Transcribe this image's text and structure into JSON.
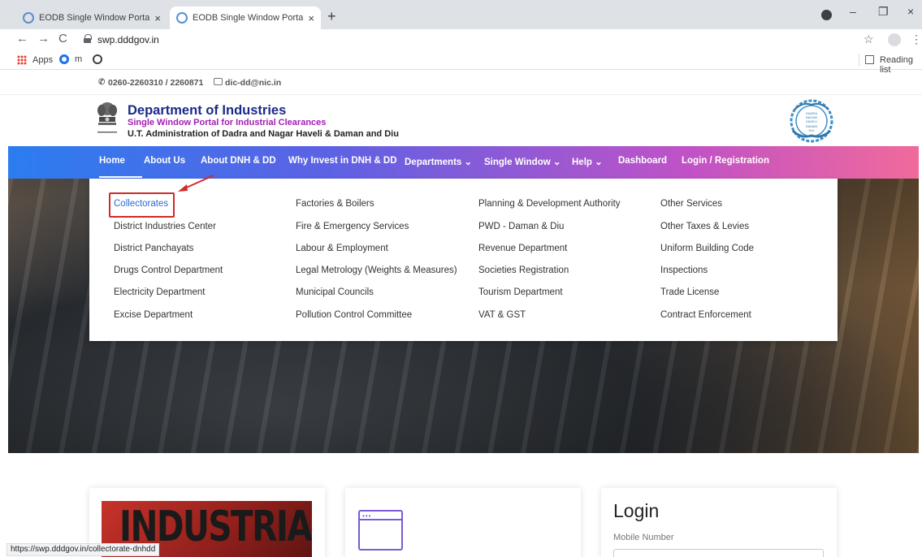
{
  "browser": {
    "tabs": [
      {
        "title": "EODB Single Window Portal : Da"
      },
      {
        "title": "EODB Single Window Portal : Da"
      }
    ],
    "new_tab": "+",
    "close_glyph": "×",
    "window_controls": [
      "–",
      "❐",
      "×"
    ],
    "back": "←",
    "forward": "→",
    "reload": "C",
    "url": "swp.dddgov.in",
    "star": "☆",
    "menu": "⋮",
    "bookmarks": {
      "apps": "Apps",
      "m": "m",
      "reading_list": "Reading list"
    },
    "status_url": "https://swp.dddgov.in/collectorate-dnhdd"
  },
  "contact": {
    "phone": "0260-2260310 / 2260871",
    "email": "dic-dd@nic.in"
  },
  "header": {
    "title": "Department of Industries",
    "subtitle": "Single Window Portal for Industrial Clearances",
    "admin": "U.T. Administration of Dadra and Nagar Haveli & Daman and Diu",
    "seal_lines": [
      "DADRA",
      "NAGAR",
      "HAVELI",
      "DAMAN",
      "DIU"
    ]
  },
  "nav": {
    "items": [
      {
        "label": "Home"
      },
      {
        "label": "About Us"
      },
      {
        "label": "About DNH & DD"
      },
      {
        "label": "Why Invest in DNH & DD"
      },
      {
        "label": "Departments ⌄"
      },
      {
        "label": "Single Window ⌄"
      },
      {
        "label": "Help ⌄"
      },
      {
        "label": "Dashboard"
      },
      {
        "label": "Login / Registration"
      }
    ]
  },
  "departments_menu": {
    "columns": [
      [
        "Collectorates",
        "District Industries Center",
        "District Panchayats",
        "Drugs Control Department",
        "Electricity Department",
        "Excise Department"
      ],
      [
        "Factories & Boilers",
        "Fire & Emergency Services",
        "Labour & Employment",
        "Legal Metrology (Weights & Measures)",
        "Municipal Councils",
        "Pollution Control Committee"
      ],
      [
        "Planning & Development Authority",
        "PWD - Daman & Diu",
        "Revenue Department",
        "Societies Registration",
        "Tourism Department",
        "VAT & GST"
      ],
      [
        "Other Services",
        "Other Taxes & Levies",
        "Uniform Building Code",
        "Inspections",
        "Trade License",
        "Contract Enforcement"
      ]
    ],
    "highlight_color": "#d12a2a"
  },
  "cards": {
    "industrial_text": "INDUSTRIAL",
    "window_dots": "•••",
    "login_title": "Login",
    "mobile_label": "Mobile Number"
  },
  "colors": {
    "nav_gradient_start": "#2b7df0",
    "nav_gradient_end": "#f06a9b",
    "title_blue": "#1b2a8a",
    "subtitle_purple": "#a21db6",
    "link_blue": "#2a6ad8"
  },
  "icons": {
    "phone": "phone-icon",
    "mail": "mail-icon",
    "lock": "lock-icon",
    "emblem": "national-emblem-icon",
    "seal": "dnhdd-seal-icon"
  }
}
